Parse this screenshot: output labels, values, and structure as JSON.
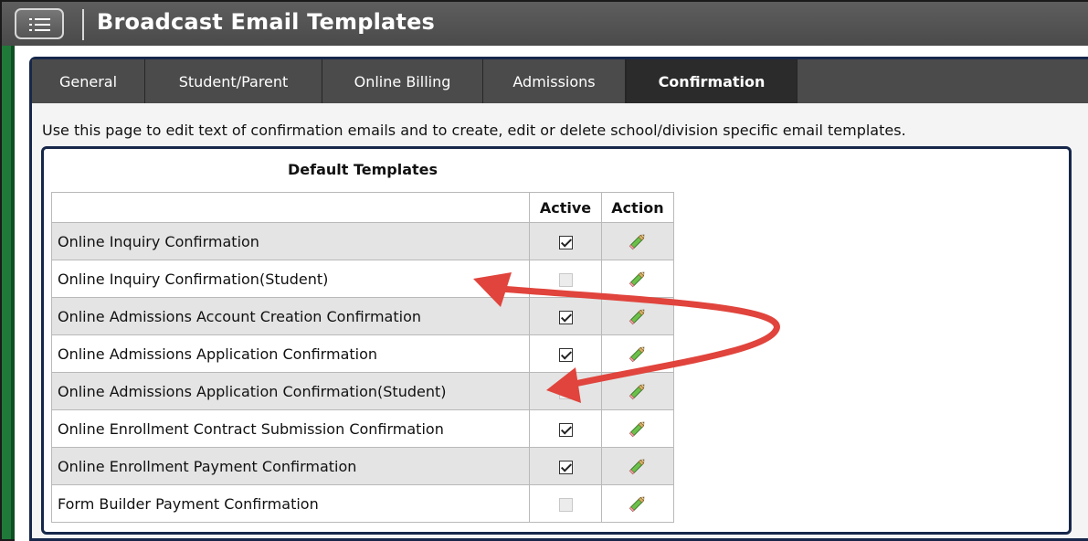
{
  "header": {
    "title": "Broadcast Email Templates",
    "menu_icon": "hamburger-list-icon"
  },
  "tabs": [
    {
      "label": "General",
      "active": false
    },
    {
      "label": "Student/Parent",
      "active": false
    },
    {
      "label": "Online Billing",
      "active": false
    },
    {
      "label": "Admissions",
      "active": false
    },
    {
      "label": "Confirmation",
      "active": true
    }
  ],
  "intro_text": "Use this page to edit text of confirmation emails and to create, edit or delete school/division specific email templates.",
  "default_templates": {
    "title": "Default Templates",
    "columns": [
      "",
      "Active",
      "Action"
    ],
    "rows": [
      {
        "name": "Online Inquiry Confirmation",
        "active": true,
        "action_icon": "edit-pencil-icon"
      },
      {
        "name": "Online Inquiry Confirmation(Student)",
        "active": false,
        "action_icon": "edit-pencil-icon"
      },
      {
        "name": "Online Admissions Account Creation Confirmation",
        "active": true,
        "action_icon": "edit-pencil-icon"
      },
      {
        "name": "Online Admissions Application Confirmation",
        "active": true,
        "action_icon": "edit-pencil-icon"
      },
      {
        "name": "Online Admissions Application Confirmation(Student)",
        "active": false,
        "action_icon": "edit-pencil-icon"
      },
      {
        "name": "Online Enrollment Contract Submission Confirmation",
        "active": true,
        "action_icon": "edit-pencil-icon"
      },
      {
        "name": "Online Enrollment Payment Confirmation",
        "active": true,
        "action_icon": "edit-pencil-icon"
      },
      {
        "name": "Form Builder Payment Confirmation",
        "active": false,
        "action_icon": "edit-pencil-icon"
      }
    ]
  },
  "colors": {
    "header_bg": "#4f4f4f",
    "tab_bg": "#4b4b4b",
    "tab_active_bg": "#2b2b2b",
    "panel_border": "#16274a",
    "row_shaded": "#e4e4e4",
    "annotation_arrow": "#e0443c",
    "left_strip": "#1f7a3a"
  }
}
